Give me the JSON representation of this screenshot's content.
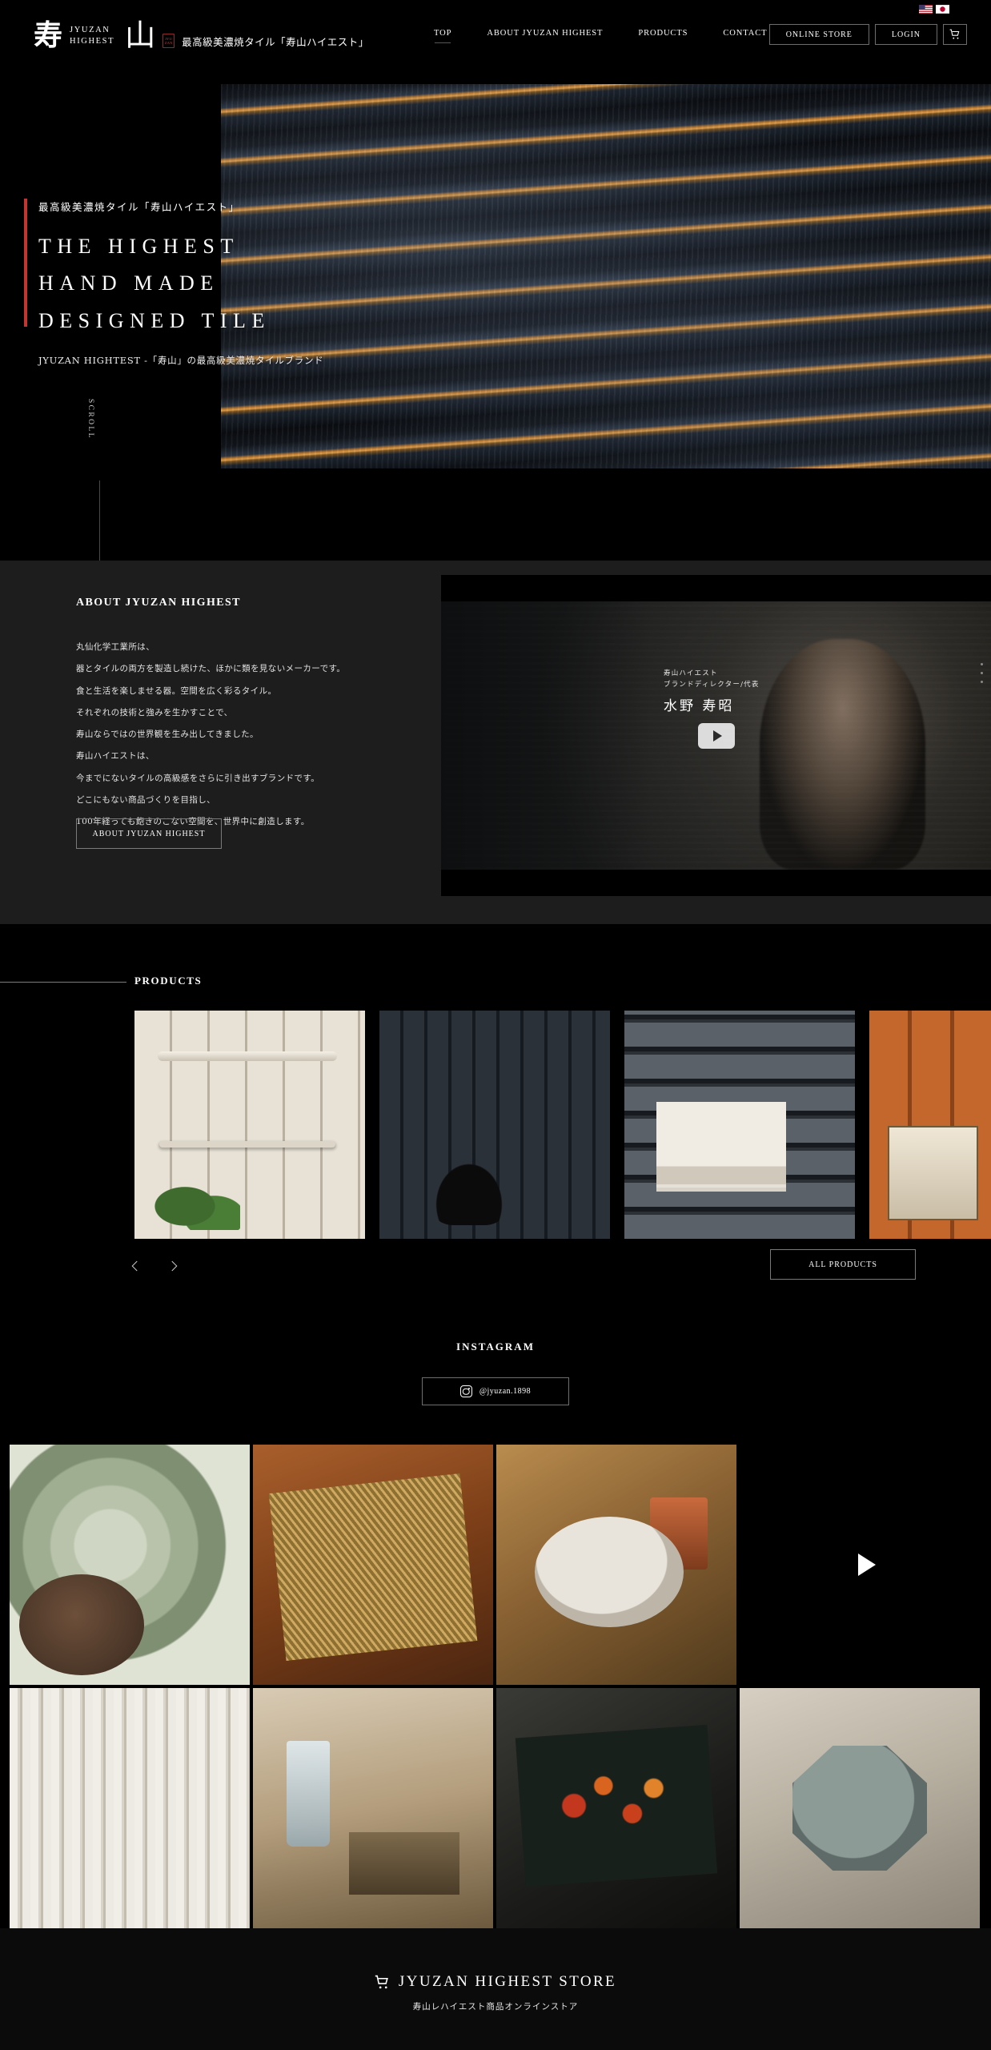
{
  "header": {
    "logo_kanji": "寿",
    "logo_kanji2": "山",
    "brand_line1": "JYUZAN",
    "brand_line2": "HIGHEST",
    "seal_line1": "JYU",
    "seal_line2": "ZAN",
    "brand_tagline": "最高級美濃焼タイル「寿山ハイエスト」",
    "nav": [
      {
        "label": "TOP",
        "active": true
      },
      {
        "label": "ABOUT JYUZAN HIGHEST",
        "active": false
      },
      {
        "label": "PRODUCTS",
        "active": false
      },
      {
        "label": "CONTACT",
        "active": false
      }
    ],
    "online_store": "ONLINE STORE",
    "login": "LOGIN",
    "cart_icon": "cart-icon",
    "lang_en_icon": "us-flag-icon",
    "lang_ja_icon": "jp-flag-icon",
    "accent_color": "#9b3a35"
  },
  "hero": {
    "kicker": "最高級美濃焼タイル「寿山ハイエスト」",
    "title_line1": "THE HIGHEST",
    "title_line2": "HAND MADE",
    "title_line3": "DESIGNED TILE",
    "subtitle": "JYUZAN HIGHTEST -「寿山」の最高級美濃焼タイルブランド",
    "scroll_label": "SCROLL",
    "bar_color": "#c4352f"
  },
  "about": {
    "heading": "ABOUT JYUZAN HIGHEST",
    "paragraphs": [
      "丸仙化学工業所は、",
      "器とタイルの両方を製造し続けた、ほかに類を見ないメーカーです。",
      "食と生活を楽しませる器。空間を広く彩るタイル。",
      "それぞれの技術と強みを生かすことで、",
      "寿山ならではの世界観を生み出してきました。",
      "寿山ハイエストは、",
      "今までにないタイルの高級感をさらに引き出すブランドです。",
      "どこにもない商品づくりを目指し、",
      "100年経っても飽きのこない空間を、世界中に創造します。"
    ],
    "button_label": "ABOUT JYUZAN HIGHEST",
    "video": {
      "caption_line1": "寿山ハイエスト",
      "caption_line2": "ブランドディレクター/代表",
      "name": "水野 寿昭",
      "play_icon": "play-icon"
    }
  },
  "products": {
    "title": "PRODUCTS",
    "items": [
      {
        "name": "product-tile-white-border"
      },
      {
        "name": "product-tile-charcoal-ribbed"
      },
      {
        "name": "product-tile-grey-wave"
      },
      {
        "name": "product-tile-terracotta-square"
      }
    ],
    "prev_icon": "chevron-left-icon",
    "next_icon": "chevron-right-icon",
    "all_products_label": "ALL PRODUCTS"
  },
  "instagram": {
    "title": "INSTAGRAM",
    "handle": "@jyuzan.1898",
    "icon": "instagram-icon",
    "gallery": [
      {
        "name": "gallery-stacked-plates"
      },
      {
        "name": "gallery-pasta-square-plate"
      },
      {
        "name": "gallery-quiche-cup"
      },
      {
        "name": "gallery-striped-tile-wall"
      },
      {
        "name": "gallery-table-setting-glasses"
      },
      {
        "name": "gallery-tomato-platter"
      },
      {
        "name": "gallery-octagonal-plate"
      }
    ],
    "video_play_icon": "play-icon"
  },
  "store": {
    "title": "JYUZAN HIGHEST STORE",
    "subtitle": "寿山レハイエスト商品オンラインストア",
    "cart_icon": "cart-icon"
  }
}
